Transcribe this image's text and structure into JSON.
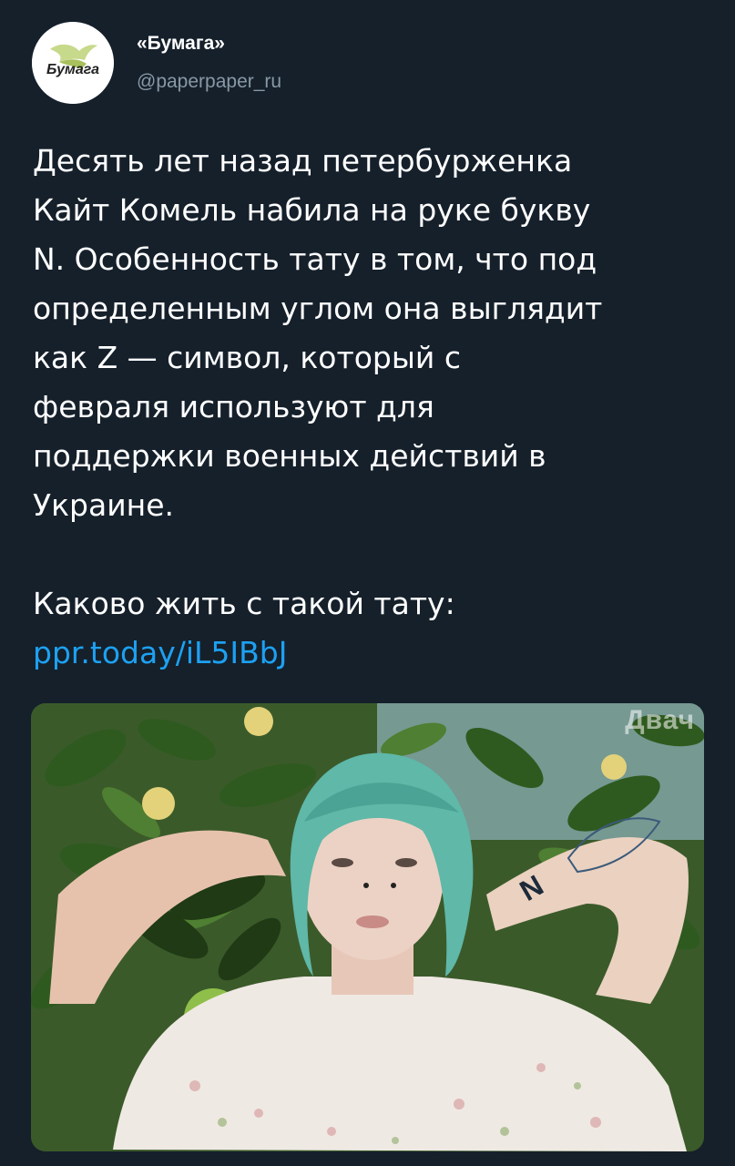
{
  "account": {
    "avatar_text": "Бумага",
    "display_name": "«Бумага»",
    "handle": "@paperpaper_ru"
  },
  "tweet": {
    "paragraph_1": "Десять лет назад петербурженка\nКайт Комель набила на руке букву\nN. Особенность тату в том, что под\nопределенным углом она выглядит\nкак Z — символ, который с\nфевраля используют для\nподдержки военных действий в\nУкраине.",
    "paragraph_2": "Каково жить с такой тату:",
    "link": "ppr.today/iL5IBbJ"
  },
  "media": {
    "watermark": "Двач",
    "tattoo_letter": "N"
  },
  "colors": {
    "background": "#15202b",
    "text": "#ffffff",
    "secondary_text": "#8899a6",
    "link": "#1da1f2"
  }
}
